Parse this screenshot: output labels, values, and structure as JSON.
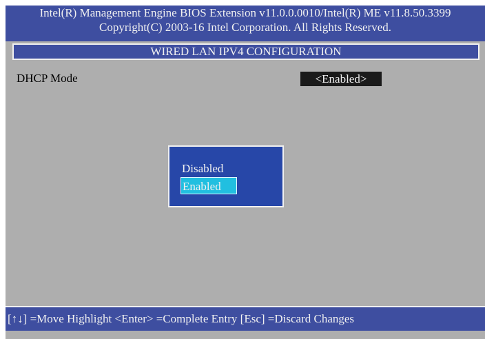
{
  "header": {
    "line1": "Intel(R) Management Engine BIOS Extension v11.0.0.0010/Intel(R) ME v11.8.50.3399",
    "line2": "Copyright(C) 2003-16 Intel Corporation. All Rights Reserved."
  },
  "section_title": "WIRED LAN IPV4 CONFIGURATION",
  "field": {
    "label": "DHCP Mode",
    "value": "<Enabled>"
  },
  "popup": {
    "options": [
      "Disabled",
      "Enabled"
    ],
    "selected": "Enabled"
  },
  "footer": {
    "hint": "[↑↓] =Move Highlight   <Enter> =Complete Entry   [Esc] =Discard Changes"
  },
  "colors": {
    "header_bg": "#3e4ea0",
    "content_bg": "#aeaeae",
    "popup_bg": "#2747a8",
    "highlight": "#21bfe0"
  }
}
